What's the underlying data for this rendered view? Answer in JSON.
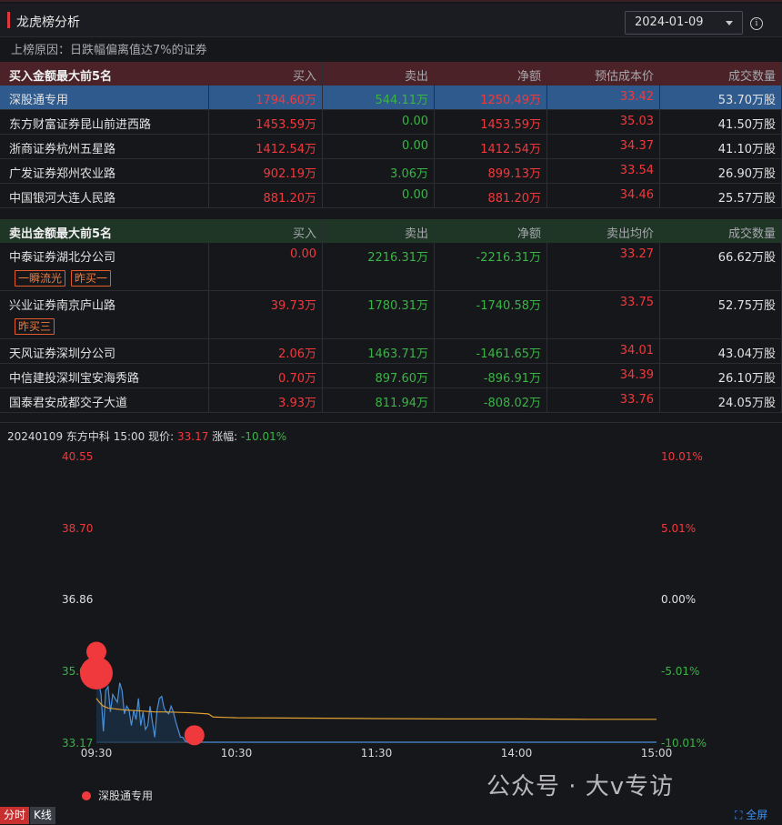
{
  "header": {
    "title": "龙虎榜分析",
    "date": "2024-01-09",
    "reason": "上榜原因：日跌幅偏离值达7%的证券"
  },
  "buy_table": {
    "columns": [
      "买入金额最大前5名",
      "买入",
      "卖出",
      "净额",
      "预估成本价",
      "成交数量"
    ],
    "rows": [
      {
        "name": "深股通专用",
        "buy": "1794.60万",
        "sell": "544.11万",
        "net": "1250.49万",
        "price": "33.42",
        "qty": "53.70万股",
        "selected": true
      },
      {
        "name": "东方财富证券昆山前进西路",
        "buy": "1453.59万",
        "sell": "0.00",
        "net": "1453.59万",
        "price": "35.03",
        "qty": "41.50万股"
      },
      {
        "name": "浙商证券杭州五星路",
        "buy": "1412.54万",
        "sell": "0.00",
        "net": "1412.54万",
        "price": "34.37",
        "qty": "41.10万股"
      },
      {
        "name": "广发证券郑州农业路",
        "buy": "902.19万",
        "sell": "3.06万",
        "net": "899.13万",
        "price": "33.54",
        "qty": "26.90万股"
      },
      {
        "name": "中国银河大连人民路",
        "buy": "881.20万",
        "sell": "0.00",
        "net": "881.20万",
        "price": "34.46",
        "qty": "25.57万股"
      }
    ]
  },
  "sell_table": {
    "columns": [
      "卖出金额最大前5名",
      "买入",
      "卖出",
      "净额",
      "卖出均价",
      "成交数量"
    ],
    "rows": [
      {
        "name": "中泰证券湖北分公司",
        "buy": "0.00",
        "sell": "2216.31万",
        "net": "-2216.31万",
        "price": "33.27",
        "qty": "66.62万股",
        "tags": [
          "一瞬流光",
          "昨买一"
        ]
      },
      {
        "name": "兴业证券南京庐山路",
        "buy": "39.73万",
        "sell": "1780.31万",
        "net": "-1740.58万",
        "price": "33.75",
        "qty": "52.75万股",
        "tags": [
          "昨买三"
        ]
      },
      {
        "name": "天风证券深圳分公司",
        "buy": "2.06万",
        "sell": "1463.71万",
        "net": "-1461.65万",
        "price": "34.01",
        "qty": "43.04万股"
      },
      {
        "name": "中信建投深圳宝安海秀路",
        "buy": "0.70万",
        "sell": "897.60万",
        "net": "-896.91万",
        "price": "34.39",
        "qty": "26.10万股"
      },
      {
        "name": "国泰君安成都交子大道",
        "buy": "3.93万",
        "sell": "811.94万",
        "net": "-808.02万",
        "price": "33.76",
        "qty": "24.05万股"
      }
    ]
  },
  "chart_info": {
    "prefix": "20240109 东方中科 15:00 现价:",
    "price": "33.17",
    "change_label": "涨幅:",
    "change": "-10.01%"
  },
  "chart_data": {
    "type": "line",
    "y_left_ticks": [
      "40.55",
      "38.70",
      "36.86",
      "35.0",
      "33.17"
    ],
    "y_right_ticks": [
      "10.01%",
      "5.01%",
      "0.00%",
      "-5.01%",
      "-10.01%"
    ],
    "x_ticks": [
      "09:30",
      "10:30",
      "11:30",
      "14:00",
      "15:00"
    ],
    "ylim": [
      33.17,
      40.55
    ],
    "x_minutes_range": [
      0,
      240
    ],
    "series": [
      {
        "name": "price",
        "x": [
          0,
          1,
          2,
          3,
          4,
          5,
          6,
          7,
          8,
          9,
          10,
          11,
          12,
          13,
          14,
          15,
          16,
          17,
          18,
          19,
          20,
          21,
          22,
          23,
          24,
          25,
          26,
          27,
          28,
          29,
          30,
          31,
          32,
          33,
          34,
          35,
          36,
          37,
          38,
          39,
          40,
          41,
          42,
          43,
          44,
          45,
          46,
          47,
          48,
          240
        ],
        "values": [
          35.1,
          34.7,
          34.4,
          33.45,
          34.5,
          34.6,
          33.95,
          34.4,
          34.3,
          34.2,
          34.7,
          34.5,
          33.9,
          34.1,
          34.0,
          33.6,
          34.0,
          33.75,
          34.3,
          33.6,
          33.95,
          33.5,
          33.6,
          34.1,
          33.7,
          33.3,
          34.0,
          34.3,
          34.35,
          34.05,
          33.95,
          33.9,
          34.1,
          33.95,
          33.7,
          33.5,
          33.3,
          33.3,
          33.2,
          33.17,
          33.17,
          33.17,
          33.17,
          33.17,
          33.17,
          33.17,
          33.17,
          33.17,
          33.17,
          33.17
        ]
      },
      {
        "name": "avg",
        "x": [
          0,
          1,
          2,
          3,
          5,
          8,
          12,
          18,
          25,
          30,
          40,
          48,
          50,
          60,
          90,
          120,
          150,
          180,
          210,
          240
        ],
        "values": [
          34.3,
          34.22,
          34.15,
          34.1,
          34.05,
          34.03,
          34.0,
          33.98,
          33.95,
          33.95,
          33.93,
          33.9,
          33.82,
          33.8,
          33.79,
          33.78,
          33.77,
          33.77,
          33.76,
          33.76
        ]
      }
    ],
    "markers": [
      {
        "x": 0,
        "y": 35.5,
        "size": "small"
      },
      {
        "x": 0,
        "y": 34.95,
        "size": "large"
      },
      {
        "x": 42,
        "y": 33.35,
        "size": "small"
      }
    ],
    "legend": "深股通专用",
    "colors": {
      "price": "#4a90d9",
      "avg": "#e0a030",
      "marker": "#f0393c",
      "up": "#f0393c",
      "down": "#3bb346",
      "neutral": "#e0e0e0"
    }
  },
  "bottom": {
    "tab_time": "分时",
    "tab_k": "K线",
    "fullscreen": "全屏",
    "watermark": "公众号 · 大v专访"
  }
}
